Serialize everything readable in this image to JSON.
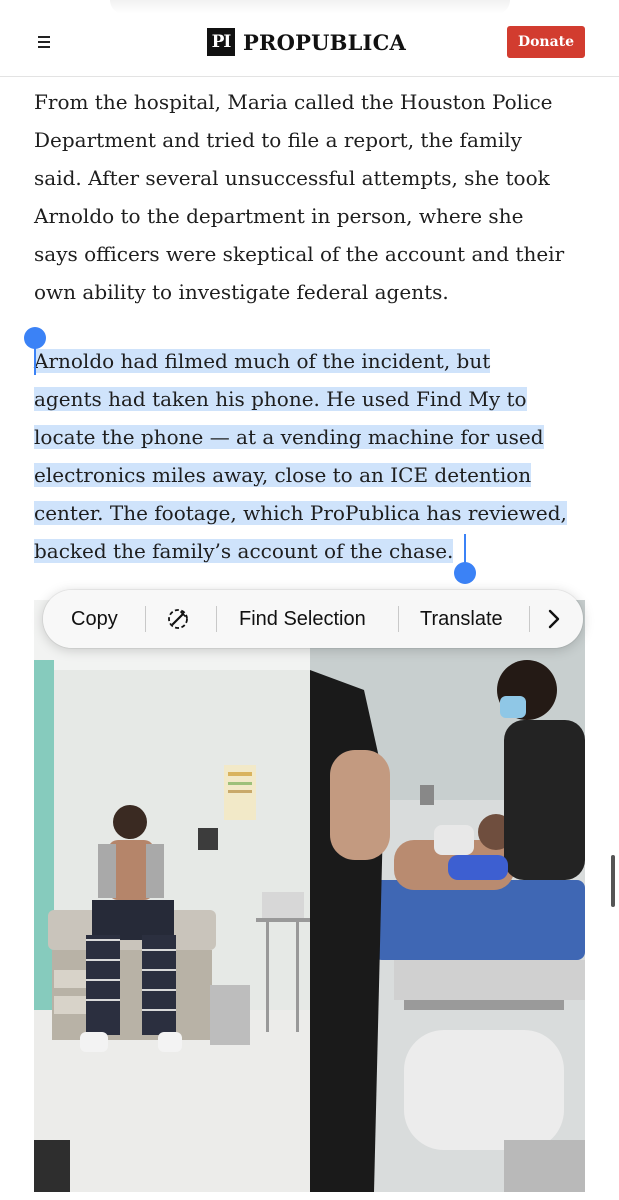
{
  "header": {
    "logo_mark": "PI",
    "logo_text": "PROPUBLICA",
    "donate_label": "Donate"
  },
  "article": {
    "para1_lines": [
      "From the hospital, Maria called the Houston Police",
      "Department and tried to file a report, the family",
      "said. After several unsuccessful attempts, she took",
      "Arnoldo to the department in person, where she",
      "says officers were skeptical of the account and their",
      "own ability to investigate federal agents."
    ],
    "para2_lines": [
      "Arnoldo had filmed much of the incident, but",
      "agents had taken his phone. He used Find My to",
      "locate the phone — at a vending machine for used",
      "electronics miles away, close to an ICE detention",
      "center. The footage, which ProPublica has reviewed,",
      "backed the family’s account of the chase."
    ]
  },
  "context_menu": {
    "copy_label": "Copy",
    "writing_tools_icon": "writing-tools-icon",
    "find_label": "Find Selection",
    "translate_label": "Translate",
    "more_icon": "chevron-right-icon"
  },
  "colors": {
    "donate": "#d23c2f",
    "selection": "#cfe3fb",
    "handle": "#3b82f6"
  }
}
